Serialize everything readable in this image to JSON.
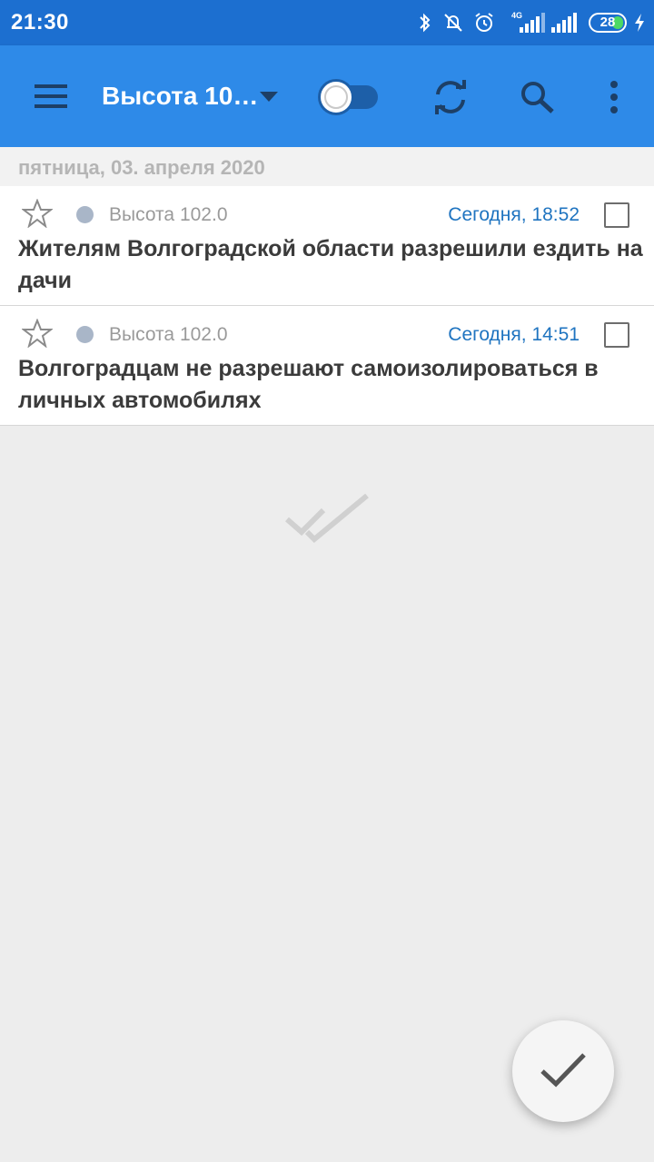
{
  "status_bar": {
    "time": "21:30",
    "network": "4G",
    "battery": "28",
    "icons": [
      "bluetooth-icon",
      "alarm-off-icon",
      "alarm-icon",
      "signal-icon",
      "signal-icon",
      "battery-icon",
      "charging-icon"
    ]
  },
  "toolbar": {
    "feed_title": "Высота 10…",
    "icons": [
      "menu-icon",
      "dropdown-icon",
      "toggle-switch",
      "refresh-icon",
      "search-icon",
      "more-icon"
    ]
  },
  "list": {
    "date_header": "пятница, 03. апреля 2020",
    "articles": [
      {
        "source": "Высота 102.0",
        "time": "Сегодня, 18:52",
        "title": "Жителям Волгоградской области разрешили ездить на дачи"
      },
      {
        "source": "Высота 102.0",
        "time": "Сегодня, 14:51",
        "title": "Волгоградцам не разрешают самоизолироваться в личных автомобилях"
      }
    ]
  },
  "colors": {
    "status_bar": "#1c6fd0",
    "toolbar": "#2e8ae8",
    "time_link": "#1f74c0",
    "background": "#ededed"
  }
}
